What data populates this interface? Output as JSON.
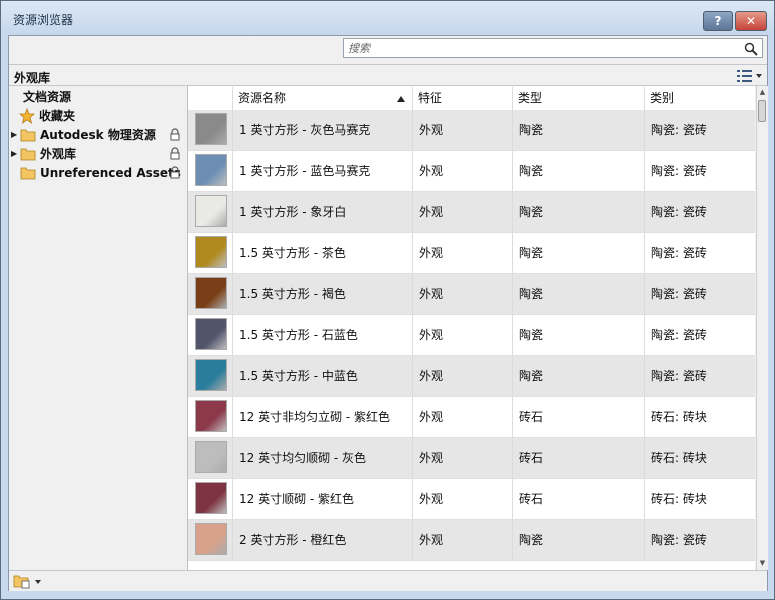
{
  "window": {
    "title": "资源浏览器",
    "help_label": "?",
    "close_label": "✕"
  },
  "search": {
    "placeholder": "搜索"
  },
  "library": {
    "label": "外观库"
  },
  "sidebar": {
    "items": [
      {
        "label": "文档资源"
      },
      {
        "label": "收藏夹"
      },
      {
        "label": "Autodesk 物理资源"
      },
      {
        "label": "外观库"
      },
      {
        "label": "Unreferenced Assets"
      }
    ]
  },
  "table": {
    "columns": [
      "资源名称",
      "特征",
      "类型",
      "类别"
    ],
    "rows": [
      {
        "name": "1 英寸方形 - 灰色马赛克",
        "feature": "外观",
        "type": "陶瓷",
        "category": "陶瓷: 瓷砖",
        "swatch": "#8a8a8a"
      },
      {
        "name": "1 英寸方形 - 蓝色马赛克",
        "feature": "外观",
        "type": "陶瓷",
        "category": "陶瓷: 瓷砖",
        "swatch": "#6d8fb3"
      },
      {
        "name": "1 英寸方形 - 象牙白",
        "feature": "外观",
        "type": "陶瓷",
        "category": "陶瓷: 瓷砖",
        "swatch": "#e9e9e6"
      },
      {
        "name": "1.5 英寸方形 - 茶色",
        "feature": "外观",
        "type": "陶瓷",
        "category": "陶瓷: 瓷砖",
        "swatch": "#b08a1e"
      },
      {
        "name": "1.5 英寸方形 - 褐色",
        "feature": "外观",
        "type": "陶瓷",
        "category": "陶瓷: 瓷砖",
        "swatch": "#7a3e16"
      },
      {
        "name": "1.5 英寸方形 - 石蓝色",
        "feature": "外观",
        "type": "陶瓷",
        "category": "陶瓷: 瓷砖",
        "swatch": "#52546b"
      },
      {
        "name": "1.5 英寸方形 - 中蓝色",
        "feature": "外观",
        "type": "陶瓷",
        "category": "陶瓷: 瓷砖",
        "swatch": "#2a7d9c"
      },
      {
        "name": "12 英寸非均匀立砌 - 紫红色",
        "feature": "外观",
        "type": "砖石",
        "category": "砖石: 砖块",
        "swatch": "#8c3a4a"
      },
      {
        "name": "12 英寸均匀顺砌 - 灰色",
        "feature": "外观",
        "type": "砖石",
        "category": "砖石: 砖块",
        "swatch": "#bdbdbd"
      },
      {
        "name": "12 英寸顺砌 - 紫红色",
        "feature": "外观",
        "type": "砖石",
        "category": "砖石: 砖块",
        "swatch": "#7e3442"
      },
      {
        "name": "2 英寸方形 - 橙红色",
        "feature": "外观",
        "type": "陶瓷",
        "category": "陶瓷: 瓷砖",
        "swatch": "#d9a08a"
      }
    ]
  }
}
